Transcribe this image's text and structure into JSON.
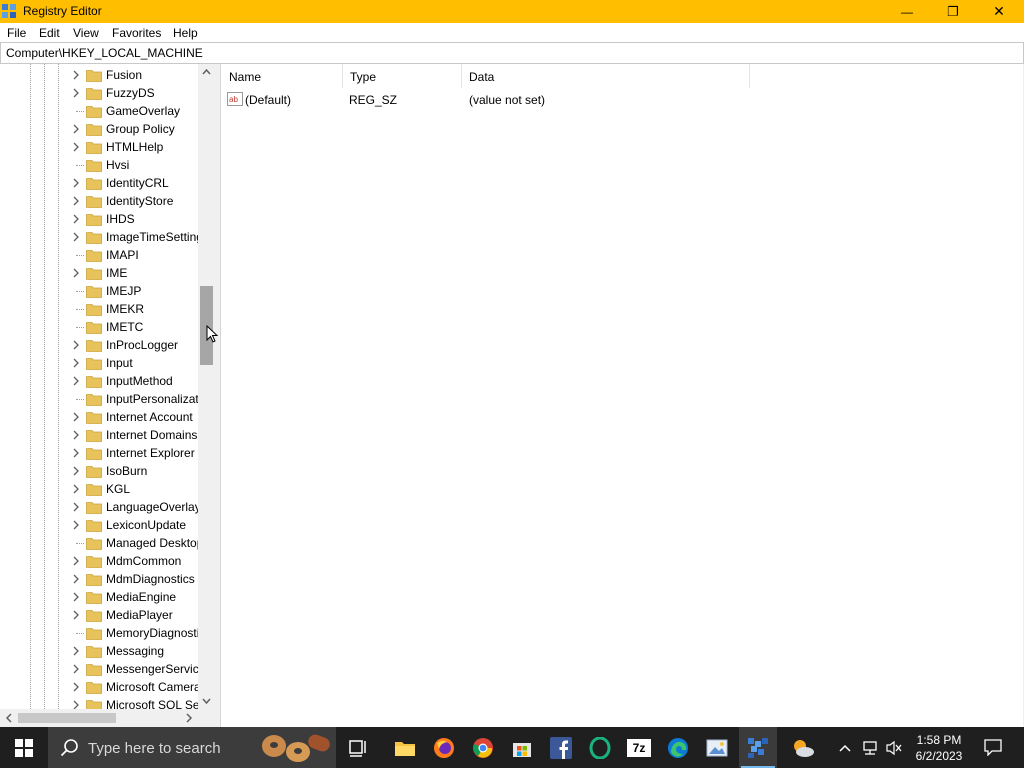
{
  "window": {
    "title": "Registry Editor",
    "minimize_glyph": "—",
    "maximize_glyph": "❐",
    "close_glyph": "✕"
  },
  "menu": [
    "File",
    "Edit",
    "View",
    "Favorites",
    "Help"
  ],
  "address_path": "Computer\\HKEY_LOCAL_MACHINE",
  "tree": {
    "items": [
      {
        "label": "Fusion",
        "expandable": true
      },
      {
        "label": "FuzzyDS",
        "expandable": true
      },
      {
        "label": "GameOverlay",
        "expandable": false
      },
      {
        "label": "Group Policy",
        "expandable": true
      },
      {
        "label": "HTMLHelp",
        "expandable": true
      },
      {
        "label": "Hvsi",
        "expandable": false
      },
      {
        "label": "IdentityCRL",
        "expandable": true
      },
      {
        "label": "IdentityStore",
        "expandable": true
      },
      {
        "label": "IHDS",
        "expandable": true
      },
      {
        "label": "ImageTimeSetting",
        "expandable": true
      },
      {
        "label": "IMAPI",
        "expandable": false
      },
      {
        "label": "IME",
        "expandable": true
      },
      {
        "label": "IMEJP",
        "expandable": false
      },
      {
        "label": "IMEKR",
        "expandable": false
      },
      {
        "label": "IMETC",
        "expandable": false
      },
      {
        "label": "InProcLogger",
        "expandable": true
      },
      {
        "label": "Input",
        "expandable": true
      },
      {
        "label": "InputMethod",
        "expandable": true
      },
      {
        "label": "InputPersonalization",
        "expandable": false
      },
      {
        "label": "Internet Account",
        "expandable": true
      },
      {
        "label": "Internet Domains",
        "expandable": true
      },
      {
        "label": "Internet Explorer",
        "expandable": true
      },
      {
        "label": "IsoBurn",
        "expandable": true
      },
      {
        "label": "KGL",
        "expandable": true
      },
      {
        "label": "LanguageOverlay",
        "expandable": true
      },
      {
        "label": "LexiconUpdate",
        "expandable": true
      },
      {
        "label": "Managed Desktop",
        "expandable": false
      },
      {
        "label": "MdmCommon",
        "expandable": true
      },
      {
        "label": "MdmDiagnostics",
        "expandable": true
      },
      {
        "label": "MediaEngine",
        "expandable": true
      },
      {
        "label": "MediaPlayer",
        "expandable": true
      },
      {
        "label": "MemoryDiagnostic",
        "expandable": false
      },
      {
        "label": "Messaging",
        "expandable": true
      },
      {
        "label": "MessengerService",
        "expandable": true
      },
      {
        "label": "Microsoft Camera",
        "expandable": true
      },
      {
        "label": "Microsoft SQL Se",
        "expandable": true
      }
    ]
  },
  "list": {
    "columns": [
      "Name",
      "Type",
      "Data"
    ],
    "rows": [
      {
        "name": "(Default)",
        "type": "REG_SZ",
        "data": "(value not set)",
        "icon": "string-value-icon"
      }
    ]
  },
  "taskbar": {
    "search_placeholder": "Type here to search",
    "apps": [
      "task-view",
      "file-explorer",
      "firefox",
      "chrome",
      "microsoft-store",
      "facebook",
      "opera",
      "7-zip",
      "edge",
      "photo-viewer",
      "registry-editor"
    ],
    "active_app": "registry-editor",
    "time": "1:58 PM",
    "date": "6/2/2023",
    "icon_7zip_text": "7z"
  },
  "colors": {
    "titlebar": "#ffbf00",
    "taskbar": "#1f1f1f",
    "folder": "#e8c25b",
    "accent": "#76b9ed"
  }
}
